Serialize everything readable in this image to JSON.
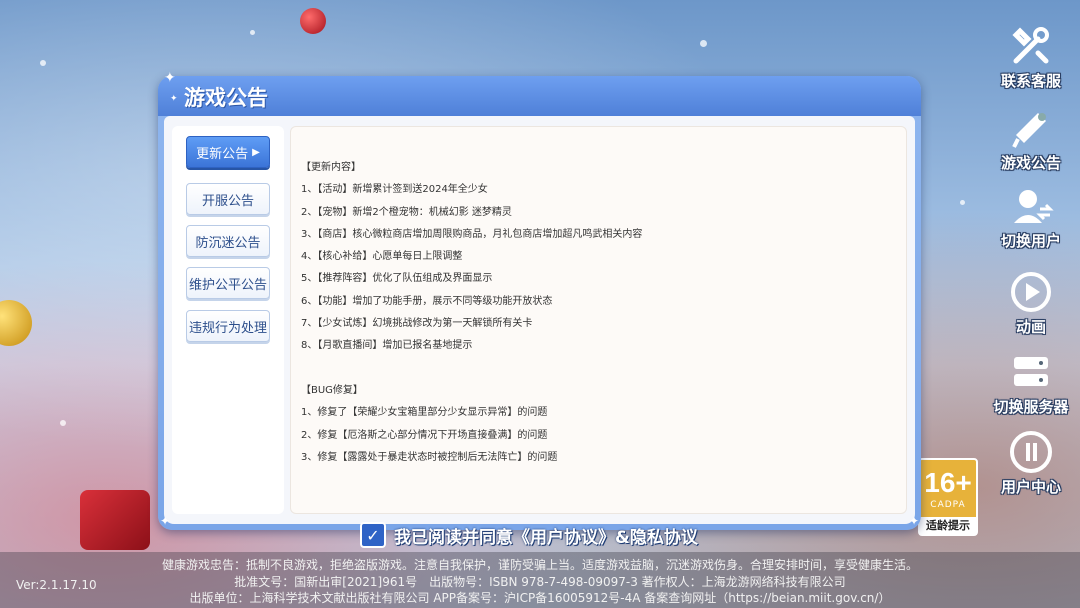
{
  "modal": {
    "title": "游戏公告",
    "tabs": [
      {
        "label": "更新公告",
        "active": true
      },
      {
        "label": "开服公告",
        "active": false
      },
      {
        "label": "防沉迷公告",
        "active": false
      },
      {
        "label": "维护公平公告",
        "active": false
      },
      {
        "label": "违规行为处理",
        "active": false
      }
    ],
    "content": {
      "section1_title": "【更新内容】",
      "section1_items": [
        "1、【活动】新增累计签到送2024年全少女",
        "2、【宠物】新增2个橙宠物：机械幻影 迷梦精灵",
        "3、【商店】核心微粒商店增加周限购商品，月礼包商店增加超凡鸣武相关内容",
        "4、【核心补给】心愿单每日上限调整",
        "5、【推荐阵容】优化了队伍组成及界面显示",
        "6、【功能】增加了功能手册，展示不同等级功能开放状态",
        "7、【少女试炼】幻境挑战修改为第一天解锁所有关卡",
        "8、【月歌直播间】增加已报名基地提示"
      ],
      "section2_title": "【BUG修复】",
      "section2_items": [
        "1、修复了【荣耀少女宝箱里部分少女显示异常】的问题",
        "2、修复【厄洛斯之心部分情况下开场直接叠满】的问题",
        "3、修复【露露处于暴走状态时被控制后无法阵亡】的问题"
      ]
    }
  },
  "sidebar": [
    {
      "label": "联系客服",
      "icon": "wrench-icon"
    },
    {
      "label": "游戏公告",
      "icon": "megaphone-icon"
    },
    {
      "label": "切换用户",
      "icon": "switch-user-icon"
    },
    {
      "label": "动画",
      "icon": "play-icon"
    },
    {
      "label": "切换服务器",
      "icon": "server-icon"
    },
    {
      "label": "用户中心",
      "icon": "user-center-icon"
    }
  ],
  "age_badge": {
    "age": "16+",
    "org": "CADPA",
    "tip": "适龄提示"
  },
  "agreement": {
    "text": "我已阅读并同意《用户协议》&隐私协议"
  },
  "footer": {
    "line1": "健康游戏忠告：抵制不良游戏，拒绝盗版游戏。注意自我保护，谨防受骗上当。适度游戏益脑，沉迷游戏伤身。合理安排时间，享受健康生活。",
    "line2": "批准文号：国新出审[2021]961号　出版物号：ISBN 978-7-498-09097-3 著作权人：上海龙游网络科技有限公司",
    "line3": "出版单位：上海科学技术文献出版社有限公司 APP备案号：沪ICP备16005912号-4A 备案查询网址（https://beian.miit.gov.cn/）",
    "version": "Ver:2.1.17.10"
  },
  "colors": {
    "modal_header": "#4f80d8",
    "active_tab": "#3b74d8",
    "tab_text": "#2d4f8c",
    "badge": "#e7b23a"
  }
}
